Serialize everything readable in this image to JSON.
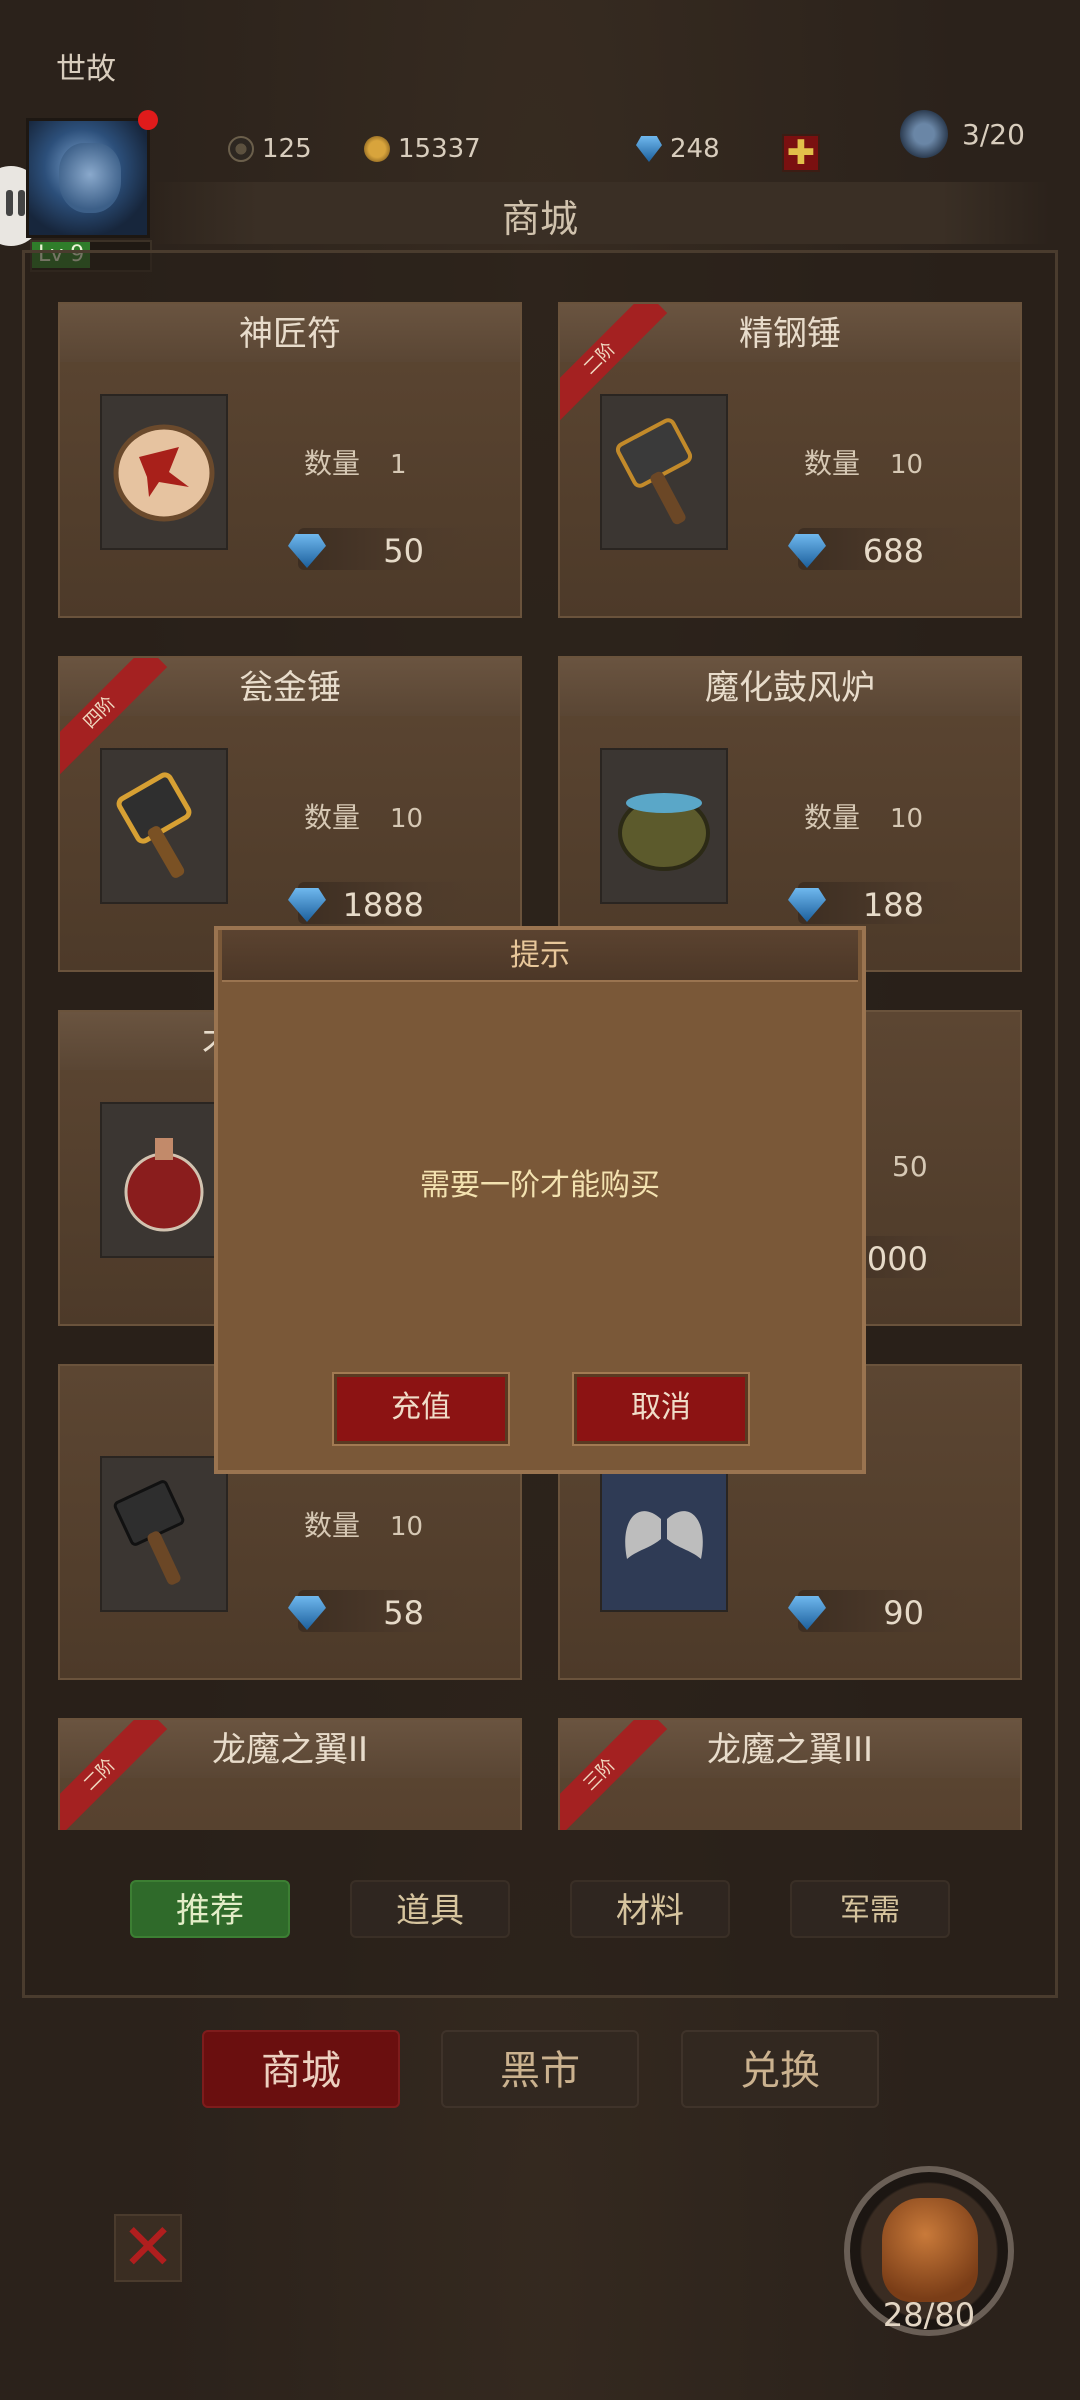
{
  "header": {
    "player_name": "世故",
    "level": "Lv 9",
    "stars": "125",
    "coins": "15337",
    "gems": "248",
    "energy": "3/20",
    "page_title": "商城"
  },
  "items": [
    {
      "name": "神匠符",
      "quantity_label": "数量",
      "quantity": "1",
      "price": "50",
      "tier": "",
      "icon": "talisman-icon"
    },
    {
      "name": "精钢锤",
      "quantity_label": "数量",
      "quantity": "10",
      "price": "688",
      "tier": "二阶",
      "icon": "steel-hammer-icon"
    },
    {
      "name": "瓮金锤",
      "quantity_label": "数量",
      "quantity": "10",
      "price": "1888",
      "tier": "四阶",
      "icon": "gold-hammer-icon"
    },
    {
      "name": "魔化鼓风炉",
      "quantity_label": "数量",
      "quantity": "10",
      "price": "188",
      "tier": "",
      "icon": "furnace-pot-icon"
    },
    {
      "name": "",
      "quantity_label": "",
      "quantity": "50",
      "price": "20000",
      "tier": "",
      "icon": "red-potion-icon",
      "name_partial": "才"
    },
    {
      "name": "",
      "quantity_label": "数量",
      "quantity": "10",
      "price": "58",
      "tier": "",
      "icon": "iron-hammer-icon"
    },
    {
      "name": "",
      "quantity_label": "",
      "quantity": "",
      "price": "90",
      "tier": "",
      "icon": "angel-wings-icon"
    },
    {
      "name": "龙魔之翼II",
      "tier": "二阶"
    },
    {
      "name": "龙魔之翼III",
      "tier": "三阶"
    }
  ],
  "category_tabs": [
    "推荐",
    "道具",
    "材料",
    "军需"
  ],
  "bottom_tabs": [
    "商城",
    "黑市",
    "兑换"
  ],
  "bag": {
    "count": "28/80"
  },
  "dialog": {
    "title": "提示",
    "message": "需要一阶才能购买",
    "confirm_label": "充值",
    "cancel_label": "取消"
  },
  "colors": {
    "active_tab": "#2f6a2a",
    "active_bottom_tab": "#6a0f0f",
    "dialog_bg": "#7a5838",
    "dialog_button": "#8c1313"
  }
}
